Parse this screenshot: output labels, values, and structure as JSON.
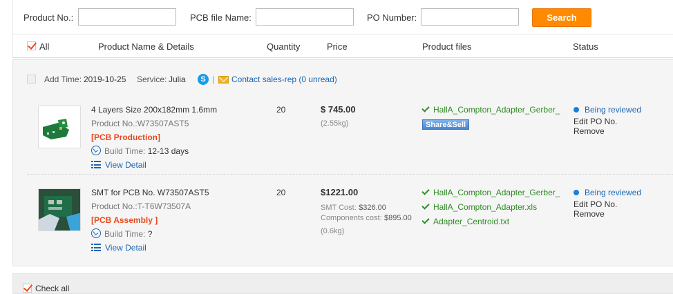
{
  "search": {
    "product_no_label": "Product No.:",
    "product_no_value": "",
    "pcb_file_label": "PCB file Name:",
    "pcb_file_value": "",
    "po_number_label": "PO Number:",
    "po_number_value": "",
    "search_button": "Search"
  },
  "header": {
    "all_label": "All",
    "all_checked": true,
    "columns": [
      "Product Name & Details",
      "Quantity",
      "Price",
      "Product files",
      "Status"
    ]
  },
  "order": {
    "add_time_label": "Add Time:",
    "add_time_value": "2019-10-25",
    "service_label": "Service:",
    "service_value": "Julia",
    "separator": "|",
    "contact_link": "Contact sales-rep (0 unread)",
    "items": [
      {
        "name": "4 Layers Size 200x182mm 1.6mm",
        "product_no_label": "Product No.:",
        "product_no_value": "W73507AST5",
        "tag": "[PCB Production]",
        "build_time_label": "Build Time:",
        "build_time_value": "12-13 days",
        "view_detail": "View Detail",
        "quantity": "20",
        "price": "$ 745.00",
        "weight": "(2.55kg)",
        "files": [
          "HallA_Compton_Adapter_Gerber_"
        ],
        "share_label": "Share&Sell",
        "status": "Being reviewed",
        "actions": [
          "Edit PO No.",
          "Remove"
        ]
      },
      {
        "name": "SMT for PCB No. W73507AST5",
        "product_no_label": "Product No.:",
        "product_no_value": "T-T6W73507A",
        "tag": "[PCB Assembly ]",
        "build_time_label": "Build Time:",
        "build_time_value": "?",
        "view_detail": "View Detail",
        "quantity": "20",
        "price": "$1221.00",
        "smt_cost_label": "SMT Cost:",
        "smt_cost_value": "$326.00",
        "components_cost_label": "Components cost:",
        "components_cost_value": "$895.00",
        "weight": "(0.6kg)",
        "files": [
          "HallA_Compton_Adapter_Gerber_",
          "HallA_Compton_Adapter.xls",
          "Adapter_Centroid.txt"
        ],
        "status": "Being reviewed",
        "actions": [
          "Edit PO No.",
          "Remove"
        ]
      }
    ]
  },
  "footer": {
    "check_all_label": "Check all",
    "check_all_checked": true
  },
  "colors": {
    "accent": "#ff8a00",
    "tag": "#e8491d",
    "link": "#1a66b5",
    "file": "#2e8b24"
  }
}
